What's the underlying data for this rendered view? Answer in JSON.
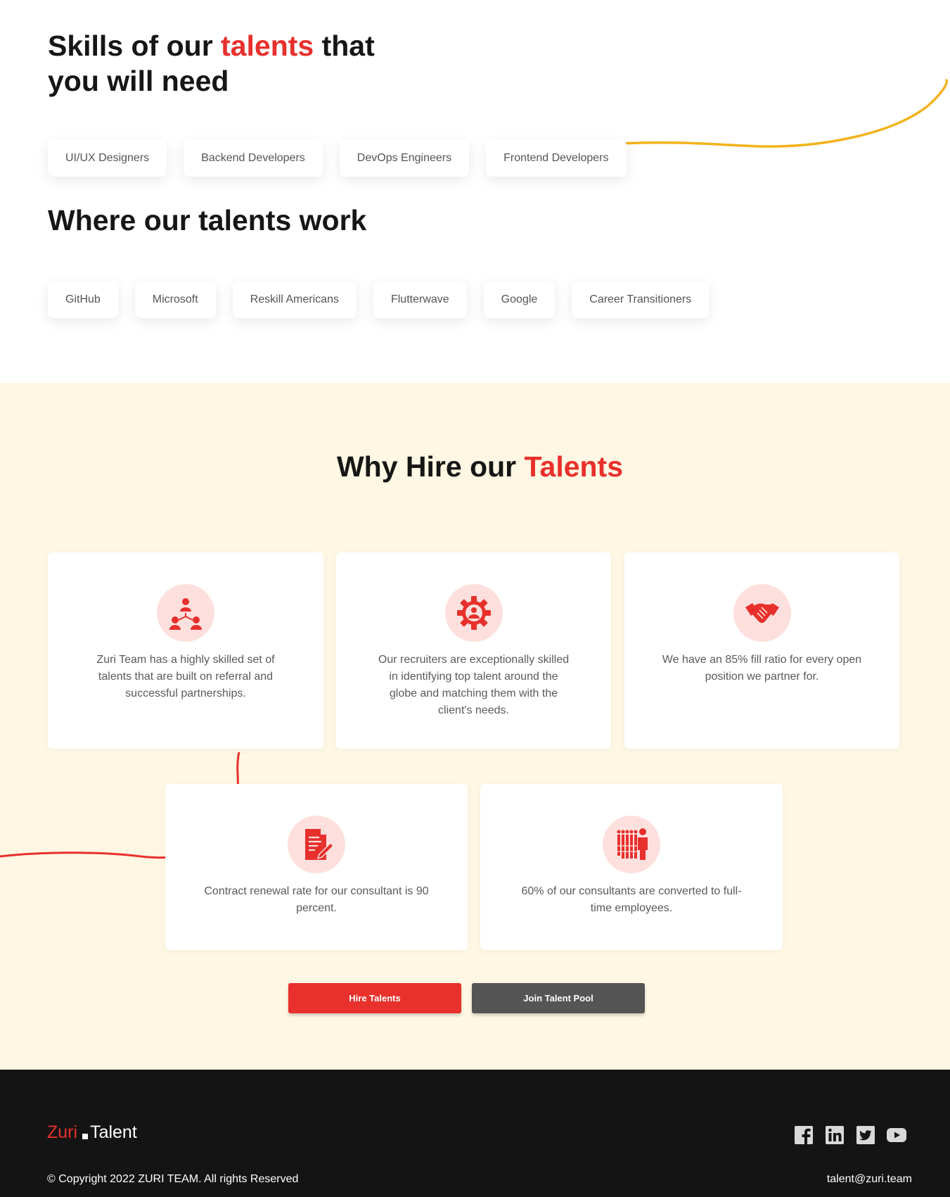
{
  "skills": {
    "title_part1": "Skills of our ",
    "title_accent": "talents",
    "title_part2": " that you will need",
    "items": [
      "UI/UX Designers",
      "Backend Developers",
      "DevOps Engineers",
      "Frontend Developers"
    ]
  },
  "work": {
    "title": "Where our talents work",
    "items": [
      "GitHub",
      "Microsoft",
      "Reskill Americans",
      "Flutterwave",
      "Google",
      "Career Transitioners"
    ]
  },
  "why": {
    "title_part1": "Why Hire our ",
    "title_accent": "Talents",
    "cards": [
      {
        "icon": "network-people-icon",
        "text": "Zuri Team has a highly skilled set of talents that are built on referral and successful partnerships."
      },
      {
        "icon": "gear-person-icon",
        "text": "Our recruiters are exceptionally skilled in identifying top talent around the globe and matching them with the client's needs."
      },
      {
        "icon": "handshake-icon",
        "text": "We have an 85% fill ratio for every open position we partner for."
      },
      {
        "icon": "contract-edit-icon",
        "text": "Contract renewal rate for our consultant is 90 percent."
      },
      {
        "icon": "employees-group-icon",
        "text": "60% of our consultants are converted to full-time employees."
      }
    ],
    "buttons": {
      "hire": "Hire Talents",
      "join": "Join Talent Pool"
    }
  },
  "footer": {
    "logo_part1": "Zuri",
    "logo_part2": "Talent",
    "socials": [
      "facebook-icon",
      "linkedin-icon",
      "twitter-icon",
      "youtube-icon"
    ],
    "copyright": "© Copyright 2022 ZURI TEAM. All rights Reserved",
    "email": "talent@zuri.team"
  },
  "colors": {
    "accent": "#e8302c",
    "cream": "#fef7e3",
    "footer": "#141414",
    "curve_yellow": "#f3b31b",
    "button_dark": "#555555",
    "icon_bg": "#fde0dd"
  }
}
